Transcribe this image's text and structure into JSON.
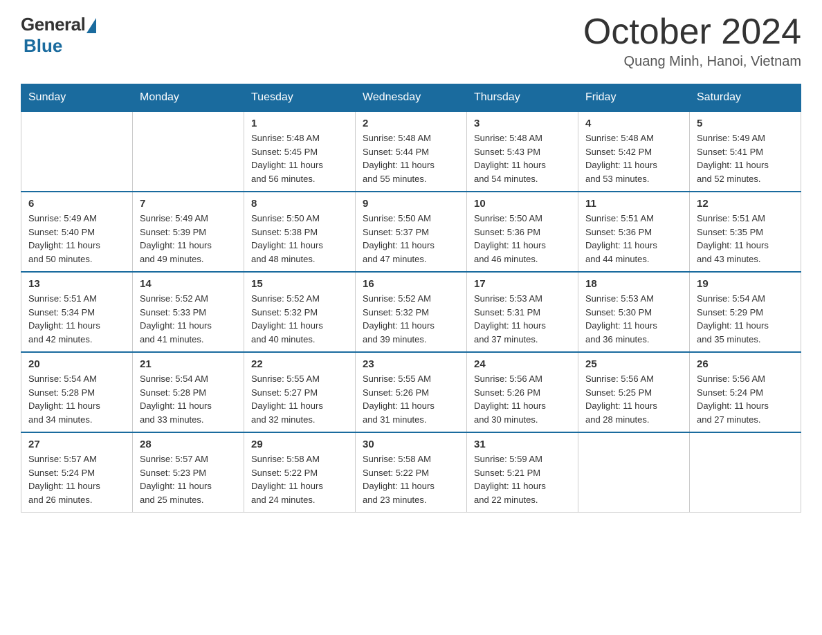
{
  "logo": {
    "general": "General",
    "blue": "Blue",
    "subtitle": "Blue"
  },
  "header": {
    "title": "October 2024",
    "location": "Quang Minh, Hanoi, Vietnam"
  },
  "days_of_week": [
    "Sunday",
    "Monday",
    "Tuesday",
    "Wednesday",
    "Thursday",
    "Friday",
    "Saturday"
  ],
  "weeks": [
    [
      {
        "day": "",
        "info": ""
      },
      {
        "day": "",
        "info": ""
      },
      {
        "day": "1",
        "info": "Sunrise: 5:48 AM\nSunset: 5:45 PM\nDaylight: 11 hours\nand 56 minutes."
      },
      {
        "day": "2",
        "info": "Sunrise: 5:48 AM\nSunset: 5:44 PM\nDaylight: 11 hours\nand 55 minutes."
      },
      {
        "day": "3",
        "info": "Sunrise: 5:48 AM\nSunset: 5:43 PM\nDaylight: 11 hours\nand 54 minutes."
      },
      {
        "day": "4",
        "info": "Sunrise: 5:48 AM\nSunset: 5:42 PM\nDaylight: 11 hours\nand 53 minutes."
      },
      {
        "day": "5",
        "info": "Sunrise: 5:49 AM\nSunset: 5:41 PM\nDaylight: 11 hours\nand 52 minutes."
      }
    ],
    [
      {
        "day": "6",
        "info": "Sunrise: 5:49 AM\nSunset: 5:40 PM\nDaylight: 11 hours\nand 50 minutes."
      },
      {
        "day": "7",
        "info": "Sunrise: 5:49 AM\nSunset: 5:39 PM\nDaylight: 11 hours\nand 49 minutes."
      },
      {
        "day": "8",
        "info": "Sunrise: 5:50 AM\nSunset: 5:38 PM\nDaylight: 11 hours\nand 48 minutes."
      },
      {
        "day": "9",
        "info": "Sunrise: 5:50 AM\nSunset: 5:37 PM\nDaylight: 11 hours\nand 47 minutes."
      },
      {
        "day": "10",
        "info": "Sunrise: 5:50 AM\nSunset: 5:36 PM\nDaylight: 11 hours\nand 46 minutes."
      },
      {
        "day": "11",
        "info": "Sunrise: 5:51 AM\nSunset: 5:36 PM\nDaylight: 11 hours\nand 44 minutes."
      },
      {
        "day": "12",
        "info": "Sunrise: 5:51 AM\nSunset: 5:35 PM\nDaylight: 11 hours\nand 43 minutes."
      }
    ],
    [
      {
        "day": "13",
        "info": "Sunrise: 5:51 AM\nSunset: 5:34 PM\nDaylight: 11 hours\nand 42 minutes."
      },
      {
        "day": "14",
        "info": "Sunrise: 5:52 AM\nSunset: 5:33 PM\nDaylight: 11 hours\nand 41 minutes."
      },
      {
        "day": "15",
        "info": "Sunrise: 5:52 AM\nSunset: 5:32 PM\nDaylight: 11 hours\nand 40 minutes."
      },
      {
        "day": "16",
        "info": "Sunrise: 5:52 AM\nSunset: 5:32 PM\nDaylight: 11 hours\nand 39 minutes."
      },
      {
        "day": "17",
        "info": "Sunrise: 5:53 AM\nSunset: 5:31 PM\nDaylight: 11 hours\nand 37 minutes."
      },
      {
        "day": "18",
        "info": "Sunrise: 5:53 AM\nSunset: 5:30 PM\nDaylight: 11 hours\nand 36 minutes."
      },
      {
        "day": "19",
        "info": "Sunrise: 5:54 AM\nSunset: 5:29 PM\nDaylight: 11 hours\nand 35 minutes."
      }
    ],
    [
      {
        "day": "20",
        "info": "Sunrise: 5:54 AM\nSunset: 5:28 PM\nDaylight: 11 hours\nand 34 minutes."
      },
      {
        "day": "21",
        "info": "Sunrise: 5:54 AM\nSunset: 5:28 PM\nDaylight: 11 hours\nand 33 minutes."
      },
      {
        "day": "22",
        "info": "Sunrise: 5:55 AM\nSunset: 5:27 PM\nDaylight: 11 hours\nand 32 minutes."
      },
      {
        "day": "23",
        "info": "Sunrise: 5:55 AM\nSunset: 5:26 PM\nDaylight: 11 hours\nand 31 minutes."
      },
      {
        "day": "24",
        "info": "Sunrise: 5:56 AM\nSunset: 5:26 PM\nDaylight: 11 hours\nand 30 minutes."
      },
      {
        "day": "25",
        "info": "Sunrise: 5:56 AM\nSunset: 5:25 PM\nDaylight: 11 hours\nand 28 minutes."
      },
      {
        "day": "26",
        "info": "Sunrise: 5:56 AM\nSunset: 5:24 PM\nDaylight: 11 hours\nand 27 minutes."
      }
    ],
    [
      {
        "day": "27",
        "info": "Sunrise: 5:57 AM\nSunset: 5:24 PM\nDaylight: 11 hours\nand 26 minutes."
      },
      {
        "day": "28",
        "info": "Sunrise: 5:57 AM\nSunset: 5:23 PM\nDaylight: 11 hours\nand 25 minutes."
      },
      {
        "day": "29",
        "info": "Sunrise: 5:58 AM\nSunset: 5:22 PM\nDaylight: 11 hours\nand 24 minutes."
      },
      {
        "day": "30",
        "info": "Sunrise: 5:58 AM\nSunset: 5:22 PM\nDaylight: 11 hours\nand 23 minutes."
      },
      {
        "day": "31",
        "info": "Sunrise: 5:59 AM\nSunset: 5:21 PM\nDaylight: 11 hours\nand 22 minutes."
      },
      {
        "day": "",
        "info": ""
      },
      {
        "day": "",
        "info": ""
      }
    ]
  ]
}
